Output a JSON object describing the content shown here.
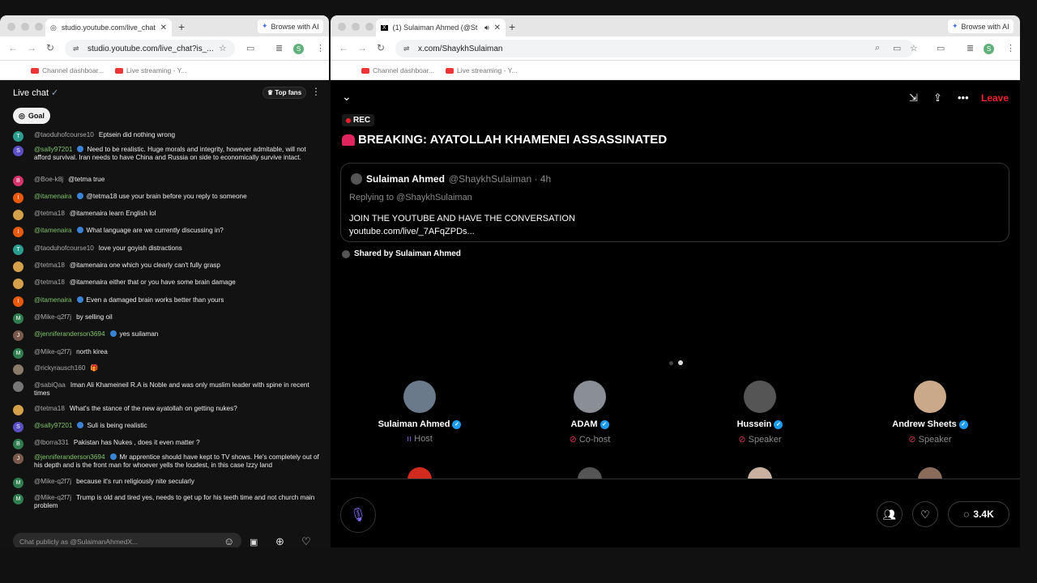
{
  "left_browser": {
    "tab_title": "studio.youtube.com/live_chat",
    "browse_ai": "Browse with AI",
    "url": "studio.youtube.com/live_chat?is_...",
    "bookmarks": [
      "Channel dashboar...",
      "Live streaming - Y..."
    ],
    "profile_initial": "S"
  },
  "right_browser": {
    "tab_title": "(1) Sulaiman Ahmed (@St",
    "browse_ai": "Browse with AI",
    "url": "x.com/ShaykhSulaiman",
    "bookmarks": [
      "Channel dashboar...",
      "Live streaming - Y..."
    ],
    "profile_initial": "S"
  },
  "chat": {
    "title": "Live chat",
    "top_fans": "Top fans",
    "goal": "Goal",
    "input_placeholder": "Chat publicly as @SulaimanAhmedX...",
    "messages": [
      {
        "initial": "T",
        "color": "#2a9d8f",
        "author": "@taoduhofcourse10",
        "member": false,
        "text": "Eptsein did nothing wrong"
      },
      {
        "initial": "S",
        "color": "#5b4fc4",
        "author": "@sally97201",
        "member": true,
        "text": "Need to be realistic. Huge morals and integrity, however admitable, will not afford survival. Iran needs to have China and Russia on side to economically survive intact."
      },
      {
        "initial": "B",
        "color": "#d6336c",
        "author": "@Boe-k8j",
        "member": false,
        "text": "@tetma true"
      },
      {
        "initial": "I",
        "color": "#e8590c",
        "author": "@itamenaira",
        "member": true,
        "text": "@tetma18 use your brain before you reply to someone"
      },
      {
        "initial": "",
        "color": "#d4a14a",
        "author": "@tetma18",
        "member": false,
        "text": "@itamenaira learn English lol"
      },
      {
        "initial": "I",
        "color": "#e8590c",
        "author": "@itamenaira",
        "member": true,
        "text": "What language are we currently discussing in?"
      },
      {
        "initial": "T",
        "color": "#2a9d8f",
        "author": "@taoduhofcourse10",
        "member": false,
        "text": "love your goyish distractions"
      },
      {
        "initial": "",
        "color": "#d4a14a",
        "author": "@tetma18",
        "member": false,
        "text": "@itamenaira one which you clearly can't fully grasp"
      },
      {
        "initial": "",
        "color": "#d4a14a",
        "author": "@tetma18",
        "member": false,
        "text": "@itamenaira either that or you have some brain damage"
      },
      {
        "initial": "I",
        "color": "#e8590c",
        "author": "@itamenaira",
        "member": true,
        "text": "Even a damaged brain works better than yours"
      },
      {
        "initial": "M",
        "color": "#2f7d4f",
        "author": "@Mike-q2f7j",
        "member": false,
        "text": "by selling oil"
      },
      {
        "initial": "J",
        "color": "#7a5a4a",
        "author": "@jenniferanderson3694",
        "member": true,
        "text": "yes suilaman"
      },
      {
        "initial": "M",
        "color": "#2f7d4f",
        "author": "@Mike-q2f7j",
        "member": false,
        "text": "north kirea"
      },
      {
        "initial": "",
        "color": "#8a7a6a",
        "author": "@rickyrausch160",
        "member": false,
        "text": "🎁"
      },
      {
        "initial": "",
        "color": "#777",
        "author": "@sabiQaa",
        "member": false,
        "text": "Iman Ali Khameineil R.A is Noble and was only muslim leader with spine in recent times"
      },
      {
        "initial": "",
        "color": "#d4a14a",
        "author": "@tetma18",
        "member": false,
        "text": "What's the stance of the new ayatollah on getting nukes?"
      },
      {
        "initial": "S",
        "color": "#5b4fc4",
        "author": "@sally97201",
        "member": true,
        "text": "Suli is being realistic"
      },
      {
        "initial": "B",
        "color": "#2f7d4f",
        "author": "@lborra331",
        "member": false,
        "text": "Pakistan has Nukes , does it even matter ?"
      },
      {
        "initial": "J",
        "color": "#7a5a4a",
        "author": "@jenniferanderson3694",
        "member": true,
        "text": "Mr apprentice should have kept to TV shows. He's completely out of his depth and is the front man for whoever yells the loudest, in this case Izzy land"
      },
      {
        "initial": "M",
        "color": "#2f7d4f",
        "author": "@Mike-q2f7j",
        "member": false,
        "text": "because it's run religiously nite secularly"
      },
      {
        "initial": "M",
        "color": "#2f7d4f",
        "author": "@Mike-q2f7j",
        "member": false,
        "text": "Trump is old and tired yes, needs to get up for his teeth time and not church main problem"
      }
    ]
  },
  "space": {
    "leave": "Leave",
    "rec": "REC",
    "title": "BREAKING: AYATOLLAH KHAMENEI ASSASSINATED",
    "tweet": {
      "name": "Sulaiman Ahmed",
      "handle": "@ShaykhSulaiman · 4h",
      "replying": "Replying to @ShaykhSulaiman",
      "line1": "JOIN THE YOUTUBE AND HAVE THE CONVERSATION",
      "line2": "youtube.com/live/_7AFqZPDs..."
    },
    "shared_by": "Shared by Sulaiman Ahmed",
    "speakers": [
      {
        "name": "Sulaiman Ahmed",
        "role": "Host",
        "color": "#6a7a8a"
      },
      {
        "name": "ADAM",
        "role": "Co-host",
        "color": "#8a8f96"
      },
      {
        "name": "Hussein",
        "role": "Speaker",
        "color": "#555"
      },
      {
        "name": "Andrew Sheets",
        "role": "Speaker",
        "color": "#c9a98a"
      }
    ],
    "listener_count": "3.4K"
  },
  "colors": {
    "leave": "#f4212e",
    "verified": "#1d9bf0",
    "member_name": "#7fc56a"
  }
}
